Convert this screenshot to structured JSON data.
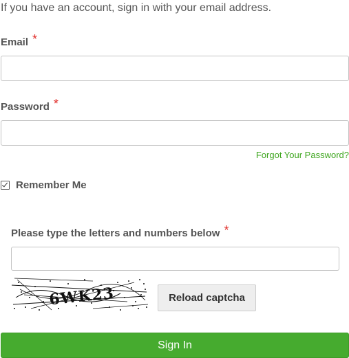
{
  "intro_text": "If you have an account, sign in with your email address.",
  "email": {
    "label": "Email",
    "required_mark": "*",
    "value": ""
  },
  "password": {
    "label": "Password",
    "required_mark": "*",
    "value": ""
  },
  "forgot_password_link": "Forgot Your Password?",
  "remember_me": {
    "label": "Remember Me",
    "checked": true
  },
  "captcha": {
    "label": "Please type the letters and numbers below",
    "required_mark": "*",
    "value": "",
    "image_text": "6WK23",
    "reload_label": "Reload captcha"
  },
  "signin_button": "Sign In",
  "colors": {
    "accent_green": "#46ab2f",
    "link_green": "#3ea61f",
    "required_red": "#e02b27"
  }
}
